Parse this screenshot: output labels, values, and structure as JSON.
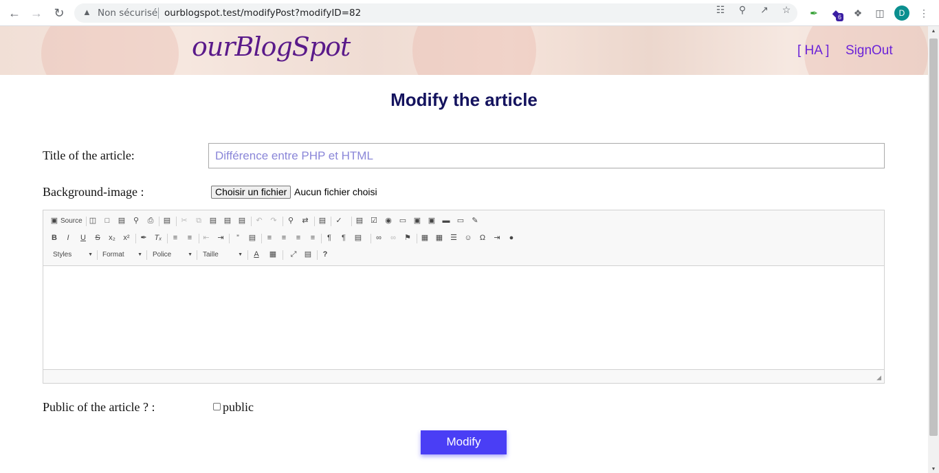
{
  "browser": {
    "security_label": "Non sécurisé",
    "url": "ourblogspot.test/modifyPost?modifyID=82",
    "extension_badge": "6",
    "profile_initial": "D"
  },
  "site": {
    "logo": "ourBlogSpot",
    "nav_user": "[ HA ]",
    "nav_signout": "SignOut"
  },
  "page": {
    "title": "Modify the article"
  },
  "form": {
    "title_label": "Title of the article:",
    "title_value": "Différence entre PHP et HTML",
    "bg_label": "Background-image :",
    "file_button": "Choisir un fichier",
    "file_status": "Aucun fichier choisi",
    "public_label": "Public of the article ? :",
    "public_checkbox_label": "public",
    "public_checked": false,
    "submit": "Modify"
  },
  "editor": {
    "source_label": "Source",
    "combos": [
      "Styles",
      "Format",
      "Police",
      "Taille"
    ],
    "help": "?"
  },
  "colors": {
    "accent": "#4a3ef5",
    "title": "#14135e",
    "nav": "#6a22d8",
    "logo": "#5a1a8a"
  }
}
